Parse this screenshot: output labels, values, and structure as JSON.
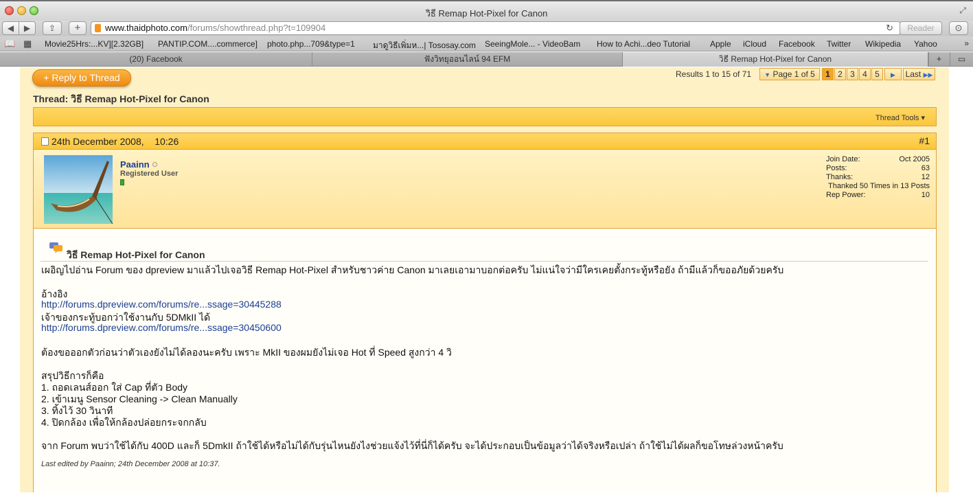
{
  "window": {
    "title": "วิธี Remap Hot-Pixel for Canon"
  },
  "toolbar": {
    "back_icon": "◀",
    "forward_icon": "▶",
    "share_icon": "⇪",
    "new_tab_icon": "+",
    "url_host": "www.thaidphoto.com",
    "url_path": "/forums/showthread.php?t=109904",
    "reload_icon": "↻",
    "reader_label": "Reader",
    "download_icon": "⊙"
  },
  "bookmarks": {
    "items": [
      "Movie25Hrs:...KV][2.32GB]",
      "PANTIP.COM....commerce]",
      "photo.php...709&type=1",
      "มาดูวิธีเพิ่มห...| Tososay.com",
      "SeeingMole... - VideoBam",
      "How to Achi...deo Tutorial",
      "Apple",
      "iCloud",
      "Facebook",
      "Twitter",
      "Wikipedia",
      "Yahoo"
    ],
    "more": "»"
  },
  "tabs": [
    {
      "label": "(20) Facebook"
    },
    {
      "label": "ฟังวิทยุออนไลน์ 94 EFM"
    },
    {
      "label": "วิธี Remap Hot-Pixel for Canon"
    }
  ],
  "tab_add": "+",
  "tab_list": "▭",
  "page": {
    "reply_label": "+ Reply to Thread",
    "results": "Results 1 to 15 of 71",
    "page_of": "Page 1 of 5",
    "pages": [
      "1",
      "2",
      "3",
      "4",
      "5"
    ],
    "next_icon": "▶",
    "last_label": "Last",
    "thread_title": "Thread: วิธี Remap Hot-Pixel for Canon",
    "thread_tools": "Thread Tools ▾"
  },
  "post": {
    "date": "24th December 2008,",
    "time": "10:26",
    "number": "#1",
    "username": "Paainn",
    "user_title": "Registered User",
    "stats": [
      {
        "label": "Join Date:",
        "value": "Oct 2005"
      },
      {
        "label": "Posts:",
        "value": "63"
      },
      {
        "label": "Thanks:",
        "value": "12"
      }
    ],
    "thanked": "Thanked 50 Times in 13 Posts",
    "rep_power_label": "Rep Power:",
    "rep_power_value": "10",
    "title": "วิธี Remap Hot-Pixel for Canon",
    "lines": [
      "เผอิญไปอ่าน Forum ของ dpreview มาแล้วไปเจอวิธี Remap Hot-Pixel สำหรับชาวค่าย Canon มาเลยเอามาบอกต่อครับ ไม่แน่ใจว่ามีใครเคยตั้งกระทู้หรือยัง ถ้ามีแล้วก็ขออภัยด้วยครับ",
      "อ้างอิง",
      "http://forums.dpreview.com/forums/re...ssage=30445288",
      "เจ้าของกระทู้บอกว่าใช้งานกับ 5DMkII ได้",
      "http://forums.dpreview.com/forums/re...ssage=30450600",
      "ต้องขอออกตัวก่อนว่าตัวเองยังไม่ได้ลองนะครับ เพราะ MkII ของผมยังไม่เจอ Hot ที่ Speed สูงกว่า 4 วิ",
      "สรุปวิธีการก็คือ",
      "1. ถอดเลนส์ออก ใส่ Cap ที่ตัว Body",
      "2. เข้าเมนู Sensor Cleaning -> Clean Manually",
      "3. ทิ้งไว้ 30 วินาที",
      "4. ปิดกล้อง เพื่อให้กล้องปล่อยกระจกกลับ",
      "จาก Forum พบว่าใช้ได้กับ 400D และก็ 5DmkII ถ้าใช้ได้หรือไม่ได้กับรุ่นไหนยังไงช่วยแจ้งไว้ที่นี่ก็ได้ครับ จะได้ประกอบเป็นข้อมูลว่าได้จริงหรือเปล่า ถ้าใช้ไม่ได้ผลก็ขอโทษล่วงหน้าครับ"
    ],
    "edited": "Last edited by Paainn; 24th December 2008 at 10:37."
  },
  "colors": {
    "accent": "#f5a623",
    "header": "#fbc63a",
    "link": "#1c3f94",
    "page_bg": "#fdf1c5"
  }
}
